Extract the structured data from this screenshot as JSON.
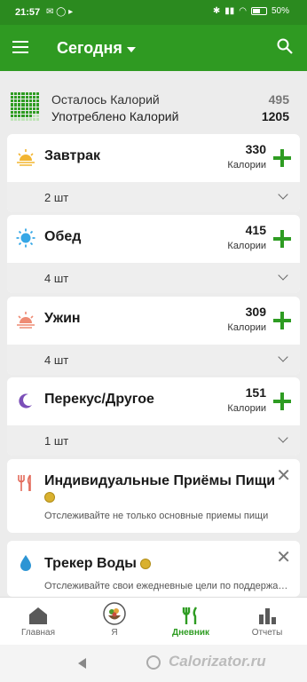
{
  "status": {
    "time": "21:57",
    "icons_left": "✉ ◯ ▸",
    "battery": "50%"
  },
  "toolbar": {
    "title": "Сегодня"
  },
  "summary": {
    "remaining_label": "Осталось Калорий",
    "remaining_value": "495",
    "consumed_label": "Употреблено Калорий",
    "consumed_value": "1205"
  },
  "meals": [
    {
      "name": "Завтрак",
      "calories": "330",
      "cal_label": "Калории",
      "count": "2 шт",
      "icon": "sunrise-icon"
    },
    {
      "name": "Обед",
      "calories": "415",
      "cal_label": "Калории",
      "count": "4 шт",
      "icon": "sun-icon"
    },
    {
      "name": "Ужин",
      "calories": "309",
      "cal_label": "Калории",
      "count": "4 шт",
      "icon": "sunset-icon"
    },
    {
      "name": "Перекус/Другое",
      "calories": "151",
      "cal_label": "Калории",
      "count": "1 шт",
      "icon": "moon-icon"
    }
  ],
  "promos": [
    {
      "title": "Индивидуальные Приёмы Пищи",
      "subtitle": "Отслеживайте не только основные приемы пищи",
      "icon": "cutlery-icon"
    },
    {
      "title": "Трекер Воды",
      "subtitle": "Отслеживайте свои ежедневные цели по поддержанию",
      "icon": "water-drop-icon"
    }
  ],
  "nav": {
    "home": "Главная",
    "me": "Я",
    "diary": "Дневник",
    "reports": "Отчеты"
  },
  "watermark": "Calorizator.ru",
  "colors": {
    "brand": "#2f9a22",
    "accent": "#2e9c22"
  }
}
